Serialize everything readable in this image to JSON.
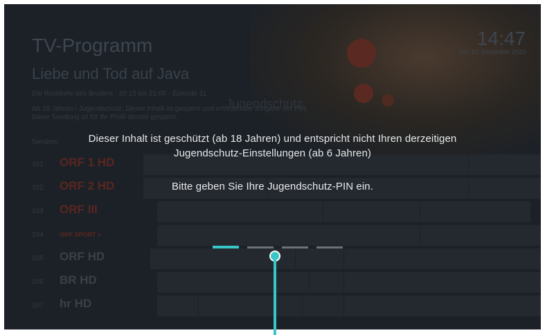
{
  "header": {
    "title": "TV-Programm",
    "clock": "14:47",
    "date": "Do, 10. Dezember 2020"
  },
  "show": {
    "title": "Liebe und Tod auf Java",
    "info_line": "Die Rückkehr des Bruders · 20:15 bis 21:00 · Episode 11",
    "rating_line1": "Ab 18 Jahren / Jugendschutz: Dieser Inhalt ist gesperrt und erfordert die Eingabe der PIN.",
    "rating_line2": "Diese Sendung ist für Ihr Profil derzeit gesperrt.",
    "jugendschutz_label": "Jugendschutz",
    "section_label": "Sendern"
  },
  "channels": [
    {
      "num": "101",
      "logo": "ORF 1 HD",
      "color": "#5a2620"
    },
    {
      "num": "102",
      "logo": "ORF 2 HD",
      "color": "#5a2620"
    },
    {
      "num": "103",
      "logo": "ORF III",
      "color": "#5a2620"
    },
    {
      "num": "104",
      "logo": "ORF SPORT +",
      "color": "#5a2620"
    },
    {
      "num": "105",
      "logo": "ORF HD",
      "color": "#3e4650"
    },
    {
      "num": "106",
      "logo": "BR HD",
      "color": "#3e4650"
    },
    {
      "num": "107",
      "logo": "hr HD",
      "color": "#3e4650"
    }
  ],
  "dialog": {
    "line1": "Dieser Inhalt ist geschützt (ab 18 Jahren) und entspricht nicht Ihren derzeitigen",
    "line2": "Jugendschutz-Einstellungen (ab 6 Jahren)",
    "prompt": "Bitte geben Sie Ihre Jugendschutz-PIN ein.",
    "pin_length": 4,
    "pin_active_index": 0
  },
  "colors": {
    "accent": "#38c6c8",
    "background": "#1c2127",
    "text": "#e8eaec"
  }
}
